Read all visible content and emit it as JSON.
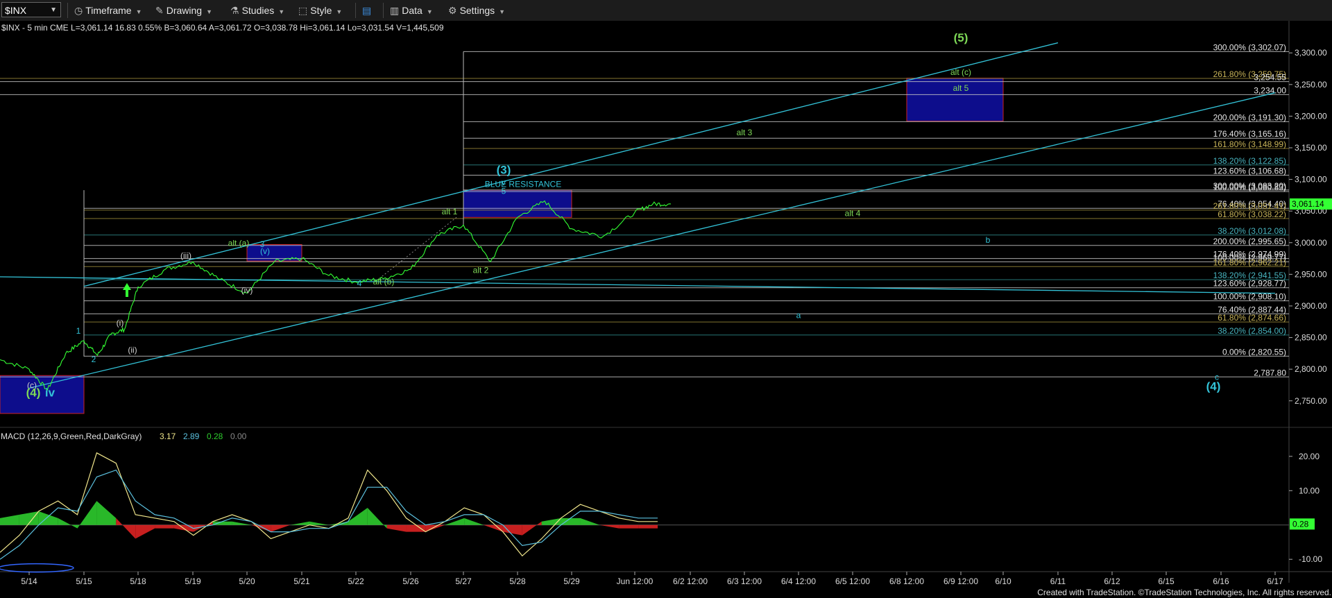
{
  "toolbar": {
    "symbol": "$INX",
    "items": [
      {
        "label": "Timeframe",
        "icon": "clock-icon"
      },
      {
        "label": "Drawing",
        "icon": "pencil-icon"
      },
      {
        "label": "Studies",
        "icon": "flask-icon"
      },
      {
        "label": "Style",
        "icon": "style-icon"
      },
      {
        "label": "",
        "icon": "layout-icon"
      },
      {
        "label": "Data",
        "icon": "data-icon"
      },
      {
        "label": "Settings",
        "icon": "gear-icon"
      }
    ]
  },
  "header_line": "$INX - 5 min  CME   L=3,061.14  16.83  0.55%   B=3,060.64  A=3,061.72    O=3,038.78  Hi=3,061.14  Lo=3,031.54  V=1,445,509",
  "footer": "Created with TradeStation. ©TradeStation Technologies, Inc. All rights reserved.",
  "colors": {
    "price": "#33ff33",
    "fib_line": "#c8c8c8",
    "trend_line": "#33c3d8",
    "box_fill": "#0d0d8c",
    "box_border_red": "#cc2222",
    "green_label": "#7ed957",
    "cyan_label": "#33c3d8",
    "macd_line": "#f0e68c",
    "signal_line": "#5bc0de",
    "hist_pos": "#2ecc2e",
    "hist_neg": "#dd2222",
    "last_price_bg": "#33ff33"
  },
  "chart_data": [
    {
      "type": "line",
      "title": "$INX - 5 min",
      "y_ticks": [
        "3,300.00",
        "3,250.00",
        "3,200.00",
        "3,150.00",
        "3,100.00",
        "3,050.00",
        "3,000.00",
        "2,950.00",
        "2,900.00",
        "2,850.00",
        "2,800.00",
        "2,750.00"
      ],
      "ylim": [
        2730,
        3320
      ],
      "x_ticks": [
        "5/14",
        "5/15",
        "5/18",
        "5/19",
        "5/20",
        "5/21",
        "5/22",
        "5/26",
        "5/27",
        "5/28",
        "5/29",
        "Jun 12:00",
        "6/2 12:00",
        "6/3 12:00",
        "6/4 12:00",
        "6/5 12:00",
        "6/8 12:00",
        "6/9 12:00",
        "6/10",
        "6/11",
        "6/12",
        "6/15",
        "6/16",
        "6/17"
      ],
      "last_price": "3,061.14",
      "series": [
        {
          "values": [
            {
              "x": "5/13",
              "y": 2815
            },
            {
              "x": "5/14",
              "y": 2800
            },
            {
              "x": "5/14",
              "y": 2767
            },
            {
              "x": "5/14",
              "y": 2825
            },
            {
              "x": "5/15",
              "y": 2845
            },
            {
              "x": "5/15",
              "y": 2822
            },
            {
              "x": "5/15",
              "y": 2855
            },
            {
              "x": "5/15",
              "y": 2863
            },
            {
              "x": "5/18",
              "y": 2930
            },
            {
              "x": "5/18",
              "y": 2958
            },
            {
              "x": "5/19",
              "y": 2970
            },
            {
              "x": "5/19",
              "y": 2942
            },
            {
              "x": "5/20",
              "y": 2920
            },
            {
              "x": "5/20",
              "y": 2970
            },
            {
              "x": "5/21",
              "y": 2975
            },
            {
              "x": "5/21",
              "y": 2948
            },
            {
              "x": "5/22",
              "y": 2938
            },
            {
              "x": "5/22",
              "y": 2943
            },
            {
              "x": "5/26",
              "y": 2958
            },
            {
              "x": "5/26",
              "y": 3012
            },
            {
              "x": "5/27",
              "y": 3028
            },
            {
              "x": "5/27",
              "y": 2970
            },
            {
              "x": "5/28",
              "y": 3040
            },
            {
              "x": "5/28",
              "y": 3066
            },
            {
              "x": "5/29",
              "y": 3022
            },
            {
              "x": "5/29",
              "y": 3010
            },
            {
              "x": "Jun 12:00",
              "y": 3048
            },
            {
              "x": "Jun 12:00",
              "y": 3061.14
            }
          ]
        }
      ],
      "fib_levels": [
        {
          "label": "300.00% (3,302.07)",
          "value": 3302.07
        },
        {
          "label": "261.80% (3,259.75)",
          "value": 3259.75
        },
        {
          "label": "3,254.55",
          "value": 3254.55
        },
        {
          "label": "3,234.00",
          "value": 3234.0
        },
        {
          "label": "200.00% (3,191.30)",
          "value": 3191.3
        },
        {
          "label": "176.40% (3,165.16)",
          "value": 3165.16
        },
        {
          "label": "161.80% (3,148.99)",
          "value": 3148.99
        },
        {
          "label": "138.20% (3,122.85)",
          "value": 3122.85
        },
        {
          "label": "123.60% (3,106.68)",
          "value": 3106.68
        },
        {
          "label": "300.00% (3,083.20)",
          "value": 3083.2
        },
        {
          "label": "100.00% (3,080.83)",
          "value": 3080.83
        },
        {
          "label": "76.40% (3,054.40)",
          "value": 3054.4
        },
        {
          "label": "261.80% (3,051.41)",
          "value": 3051.41
        },
        {
          "label": "61.80% (3,038.22)",
          "value": 3038.22
        },
        {
          "label": "38.20% (3,012.08)",
          "value": 3012.08
        },
        {
          "label": "200.00% (2,995.65)",
          "value": 2995.65
        },
        {
          "label": "176.40% (2,974.99)",
          "value": 2974.99
        },
        {
          "label": "100.00% (2,969.77)",
          "value": 2969.77
        },
        {
          "label": "161.80% (2,962.21)",
          "value": 2962.21
        },
        {
          "label": "138.20% (2,941.55)",
          "value": 2941.55
        },
        {
          "label": "123.60% (2,928.77)",
          "value": 2928.77
        },
        {
          "label": "100.00% (2,908.10)",
          "value": 2908.1
        },
        {
          "label": "76.40% (2,887.44)",
          "value": 2887.44
        },
        {
          "label": "61.80% (2,874.66)",
          "value": 2874.66
        },
        {
          "label": "38.20% (2,854.00)",
          "value": 2854.0
        },
        {
          "label": "0.00% (2,820.55)",
          "value": 2820.55
        },
        {
          "label": "2,787.80",
          "value": 2787.8
        }
      ],
      "annotations": [
        {
          "text": "(5)",
          "x": "6/9 12:00",
          "y": 3318,
          "color": "green",
          "size": "large"
        },
        {
          "text": "alt (c)",
          "x": "6/9 12:00",
          "y": 3265,
          "color": "green"
        },
        {
          "text": "alt 5",
          "x": "6/9 12:00",
          "y": 3240,
          "color": "green"
        },
        {
          "text": "alt 3",
          "x": "6/3 12:00",
          "y": 3170,
          "color": "green"
        },
        {
          "text": "(3)",
          "x": "5/28",
          "y": 3109,
          "color": "cyan",
          "size": "large"
        },
        {
          "text": "v",
          "x": "5/28",
          "y": 3091,
          "color": "cyan"
        },
        {
          "text": "5",
          "x": "5/28",
          "y": 3077,
          "color": "cyan"
        },
        {
          "text": "BLUE RESISTANCE",
          "x": "5/29",
          "y": 3088,
          "color": "cyan"
        },
        {
          "text": "alt 1",
          "x": "5/27",
          "y": 3045,
          "color": "green"
        },
        {
          "text": "alt 4",
          "x": "6/5 12:00",
          "y": 3042,
          "color": "green"
        },
        {
          "text": "b",
          "x": "6/10",
          "y": 3000,
          "color": "cyan"
        },
        {
          "text": "alt (a)",
          "x": "5/20",
          "y": 2995,
          "color": "green"
        },
        {
          "text": "3",
          "x": "5/20",
          "y": 2993,
          "color": "cyan"
        },
        {
          "text": "(v)",
          "x": "5/20",
          "y": 2982,
          "color": "cyan"
        },
        {
          "text": "(iii)",
          "x": "5/19",
          "y": 2975,
          "color": "white"
        },
        {
          "text": "alt 2",
          "x": "5/27",
          "y": 2952,
          "color": "green"
        },
        {
          "text": "4",
          "x": "5/22",
          "y": 2931,
          "color": "cyan"
        },
        {
          "text": "alt (b)",
          "x": "5/22",
          "y": 2934,
          "color": "green"
        },
        {
          "text": "(iv)",
          "x": "5/20",
          "y": 2920,
          "color": "white"
        },
        {
          "text": "a",
          "x": "6/4 12:00",
          "y": 2881,
          "color": "cyan"
        },
        {
          "text": "(i)",
          "x": "5/15",
          "y": 2869,
          "color": "white"
        },
        {
          "text": "1",
          "x": "5/15",
          "y": 2856,
          "color": "cyan"
        },
        {
          "text": "(ii)",
          "x": "5/15",
          "y": 2826,
          "color": "white"
        },
        {
          "text": "2",
          "x": "5/15",
          "y": 2811,
          "color": "cyan"
        },
        {
          "text": "c",
          "x": "6/16",
          "y": 2783,
          "color": "cyan"
        },
        {
          "text": "(4)",
          "x": "6/16",
          "y": 2767,
          "color": "cyan",
          "size": "large"
        },
        {
          "text": "(c)",
          "x": "5/14",
          "y": 2770,
          "color": "white"
        },
        {
          "text": "(4)",
          "x": "5/14",
          "y": 2757,
          "color": "green",
          "size": "large"
        },
        {
          "text": "iv",
          "x": "5/14",
          "y": 2757,
          "color": "cyan",
          "size": "large"
        }
      ],
      "boxes": [
        {
          "name": "target-box-5",
          "x0": "6/8 12:00",
          "x1": "6/10",
          "y0": 3192,
          "y1": 3260
        },
        {
          "name": "blue-resistance-box",
          "x0": "5/27",
          "x1": "5/29",
          "y0": 3040,
          "y1": 3083
        },
        {
          "name": "alt-a-box",
          "x0": "5/20",
          "x1": "5/21",
          "y0": 2971,
          "y1": 2997
        },
        {
          "name": "support-box",
          "x0": "5/13",
          "x1": "5/15",
          "y0": 2730,
          "y1": 2790
        }
      ],
      "trend_lines": [
        {
          "from": {
            "x": "5/15",
            "y": 2931
          },
          "to": {
            "x": "6/11",
            "y": 3316
          }
        },
        {
          "from": {
            "x": "5/14",
            "y": 2770
          },
          "to": {
            "x": "6/17",
            "y": 3237
          }
        },
        {
          "from": {
            "x": "5/13",
            "y": 2946
          },
          "to": {
            "x": "6/17",
            "y": 2920
          }
        }
      ]
    },
    {
      "type": "line",
      "title": "MACD (12,26,9,Green,Red,DarkGray)",
      "legend_values": [
        "3.17",
        "2.89",
        "0.28",
        "0.00"
      ],
      "y_ticks": [
        "20.00",
        "10.00",
        "-10.00"
      ],
      "ylim": [
        -14,
        24
      ],
      "last_value": "0.28",
      "series": [
        {
          "name": "MACD",
          "values": [
            -8,
            -3,
            4,
            7,
            3,
            21,
            18,
            3,
            2,
            1,
            -3,
            1,
            3,
            1,
            -4,
            -2,
            0,
            -1,
            2,
            16,
            10,
            2,
            -2,
            1,
            5,
            3,
            -2,
            -9,
            -4,
            2,
            6,
            4,
            2,
            1,
            1
          ]
        },
        {
          "name": "Signal",
          "values": [
            -10,
            -6,
            0,
            5,
            4,
            14,
            16,
            7,
            3,
            2,
            -1,
            0,
            2,
            1,
            -2,
            -2,
            -1,
            -1,
            1,
            11,
            11,
            4,
            0,
            1,
            3,
            3,
            0,
            -6,
            -5,
            0,
            4,
            4,
            3,
            2,
            2
          ]
        },
        {
          "name": "Histogram",
          "values": [
            2,
            3,
            4,
            2,
            -1,
            7,
            2,
            -4,
            -1,
            -1,
            -2,
            1,
            1,
            0,
            -2,
            0,
            1,
            0,
            1,
            5,
            -1,
            -2,
            -2,
            0,
            2,
            0,
            -2,
            -3,
            1,
            2,
            2,
            0,
            -1,
            -1,
            -1
          ]
        }
      ]
    }
  ]
}
